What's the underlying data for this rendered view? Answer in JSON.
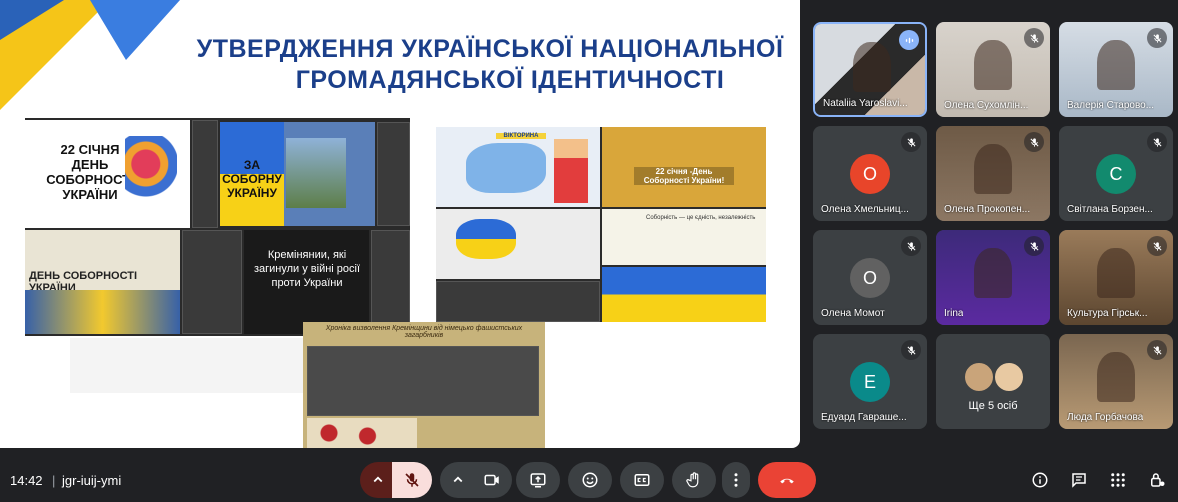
{
  "slide": {
    "title_line1": "УТВЕРДЖЕННЯ УКРАЇНСЬКОЇ НАЦІОНАЛЬНОЇ",
    "title_line2": "ГРОМАДЯНСЬКОЇ ІДЕНТИЧНОСТІ",
    "card1_text": "22 СІЧНЯ ДЕНЬ СОБОРНОСТІ УКРАЇНИ",
    "card2_text": "ЗА СОБОРНУ УКРАЇНУ",
    "card3_text": "ДЕНЬ СОБОРНОСТІ УКРАЇНИ",
    "card4_text": "Кремінянии, які загинули у війні росії проти України",
    "card5_text": "ВІКТОРИНА",
    "card6_text": "22 січня -День Соборності України!",
    "card7_text": "Соборність — це єдність, незалежність",
    "card8_text": "Хроніка визволення Кремінщини від німецько фашистських загарбників"
  },
  "participants": [
    {
      "name": "Nataliia Yaroslavi...",
      "initial": "",
      "color": "",
      "mic": "speaking",
      "photo": true
    },
    {
      "name": "Олена Сухомлін...",
      "initial": "",
      "color": "",
      "mic": "muted",
      "photo": true
    },
    {
      "name": "Валерія Старово...",
      "initial": "",
      "color": "",
      "mic": "muted",
      "photo": true
    },
    {
      "name": "Олена Хмельниц...",
      "initial": "О",
      "color": "#e8452a",
      "mic": "muted",
      "photo": false
    },
    {
      "name": "Олена Прокопен...",
      "initial": "",
      "color": "",
      "mic": "muted",
      "photo": true
    },
    {
      "name": "Світлана Борзен...",
      "initial": "С",
      "color": "#128a6e",
      "mic": "muted",
      "photo": false
    },
    {
      "name": "Олена Момот",
      "initial": "О",
      "color": "#616161",
      "mic": "muted",
      "photo": false
    },
    {
      "name": "Irina",
      "initial": "",
      "color": "",
      "mic": "muted",
      "photo": true
    },
    {
      "name": "Культура Гірськ...",
      "initial": "",
      "color": "",
      "mic": "muted",
      "photo": true
    },
    {
      "name": "Едуард Гавраше...",
      "initial": "Е",
      "color": "#0a8a8a",
      "mic": "muted",
      "photo": false
    },
    {
      "name": "Ще 5 осіб",
      "initial": "",
      "color": "",
      "mic": "",
      "photo": false
    },
    {
      "name": "Люда Горбачова",
      "initial": "",
      "color": "",
      "mic": "muted",
      "photo": true
    }
  ],
  "bottom_bar": {
    "time": "14:42",
    "separator": "|",
    "meeting_code": "jgr-iuij-ymi"
  },
  "colors": {
    "accent_red": "#ea4335",
    "bg": "#202124",
    "button": "#3c4043"
  }
}
